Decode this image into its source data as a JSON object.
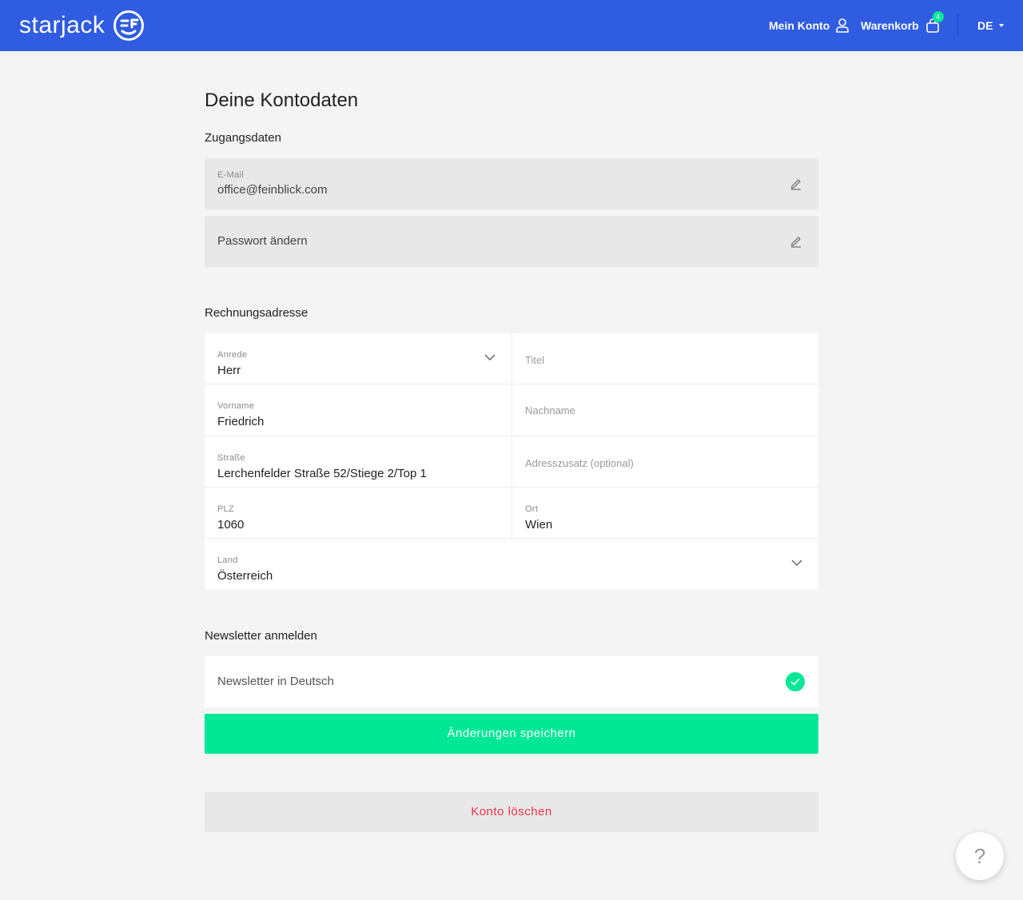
{
  "header": {
    "logo_text": "starjack",
    "account_label": "Mein Konto",
    "cart_label": "Warenkorb",
    "cart_count": "4",
    "language": "DE",
    "brand_color": "#2f5ce1"
  },
  "page": {
    "title": "Deine Kontodaten"
  },
  "access": {
    "section_title": "Zugangsdaten",
    "email_label": "E-Mail",
    "email_value": "office@feinblick.com",
    "password_label": "Passwort ändern"
  },
  "billing": {
    "section_title": "Rechnungsadresse",
    "salutation_label": "Anrede",
    "salutation_value": "Herr",
    "title_placeholder": "Titel",
    "firstname_label": "Vorname",
    "firstname_value": "Friedrich",
    "lastname_placeholder": "Nachname",
    "street_label": "Straße",
    "street_value": "Lerchenfelder Straße 52/Stiege 2/Top 1",
    "address_extra_placeholder": "Adresszusatz (optional)",
    "zip_label": "PLZ",
    "zip_value": "1060",
    "city_label": "Ort",
    "city_value": "Wien",
    "country_label": "Land",
    "country_value": "Österreich"
  },
  "newsletter": {
    "section_title": "Newsletter anmelden",
    "option_label": "Newsletter in Deutsch",
    "checked": true
  },
  "actions": {
    "save_label": "Änderungen speichern",
    "delete_label": "Konto löschen",
    "accent_color": "#00e896",
    "danger_color": "#e8334a"
  },
  "help": {
    "label": "?"
  }
}
